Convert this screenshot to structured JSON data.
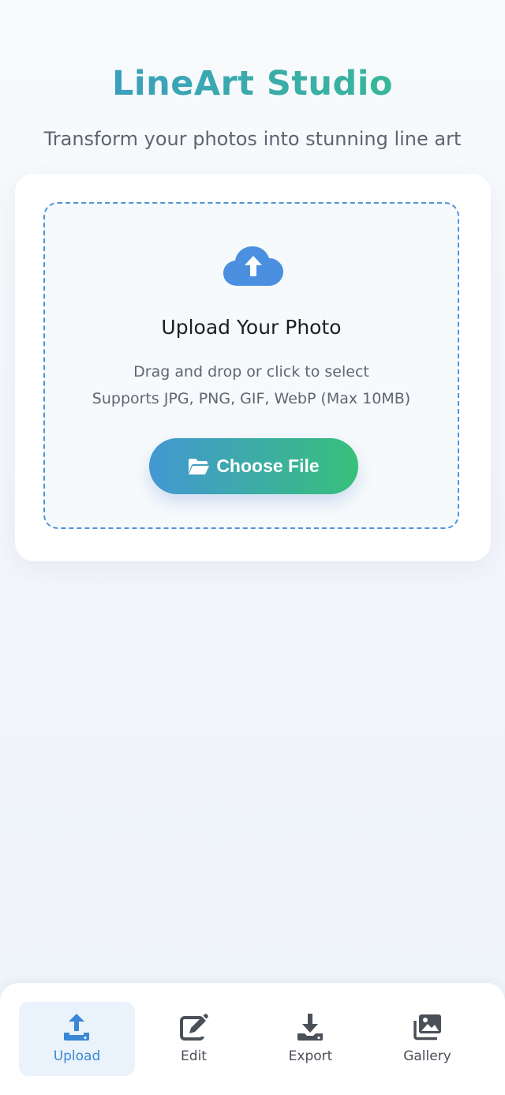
{
  "header": {
    "title": "LineArt Studio",
    "subtitle": "Transform your photos into stunning line art"
  },
  "upload": {
    "heading": "Upload Your Photo",
    "hint_line1": "Drag and drop or click to select",
    "hint_line2": "Supports JPG, PNG, GIF, WebP (Max 10MB)",
    "button_label": "Choose File",
    "icon": "cloud-upload-icon",
    "button_icon": "folder-open-icon"
  },
  "bottom_nav": {
    "active": "Upload",
    "items": [
      {
        "label": "Upload",
        "icon": "upload-icon"
      },
      {
        "label": "Edit",
        "icon": "edit-icon"
      },
      {
        "label": "Export",
        "icon": "download-icon"
      },
      {
        "label": "Gallery",
        "icon": "gallery-icon"
      }
    ]
  },
  "colors": {
    "accent_blue": "#3a87d6",
    "accent_green": "#36bf8a",
    "dashed_border": "#4f93d9",
    "nav_active_bg": "#eaf2fb",
    "icon_dark": "#4a5058"
  }
}
